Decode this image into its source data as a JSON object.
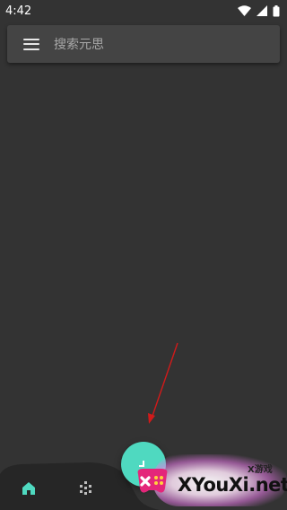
{
  "status_bar": {
    "time": "4:42"
  },
  "search": {
    "placeholder": "搜索元思"
  },
  "colors": {
    "background": "#333333",
    "search_bar": "#444444",
    "accent": "#4fd9c0",
    "arrow": "#d11a1a"
  },
  "icons": {
    "menu": "menu-icon",
    "home": "home-icon",
    "explore": "explore-icon",
    "fab": "fab-icon",
    "wifi": "wifi-icon",
    "signal": "signal-icon",
    "battery": "battery-icon"
  },
  "watermark": {
    "tag": "X游戏",
    "text": "XYouXi.net"
  }
}
